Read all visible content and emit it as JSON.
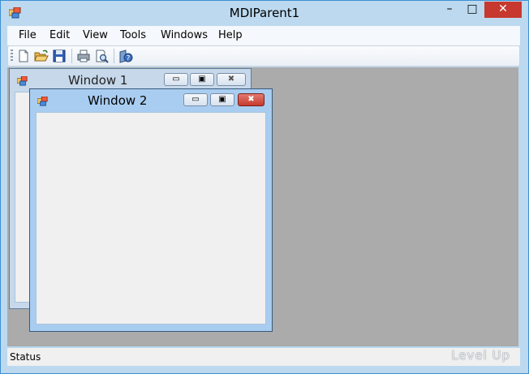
{
  "app": {
    "title": "MDIParent1"
  },
  "caption_buttons": {
    "minimize": "–",
    "maximize": "□",
    "close": "✕"
  },
  "menu": [
    "File",
    "Edit",
    "View",
    "Tools",
    "Windows",
    "Help"
  ],
  "toolbar": {
    "buttons": [
      "new-icon",
      "open-icon",
      "save-icon",
      "print-icon",
      "print-preview-icon",
      "help-icon"
    ]
  },
  "children": [
    {
      "title": "Window 1"
    },
    {
      "title": "Window 2"
    }
  ],
  "child_buttons": {
    "minimize": "▭",
    "maximize": "▣",
    "close": "✖"
  },
  "status": {
    "text": "Status"
  },
  "watermark": "Level Up",
  "colors": {
    "title_bg": "#bcd9ef",
    "close_red": "#c7392e",
    "mdi_bg": "#ababab",
    "child_active": "#a9cdf0",
    "child_inactive": "#c6d8ea"
  }
}
